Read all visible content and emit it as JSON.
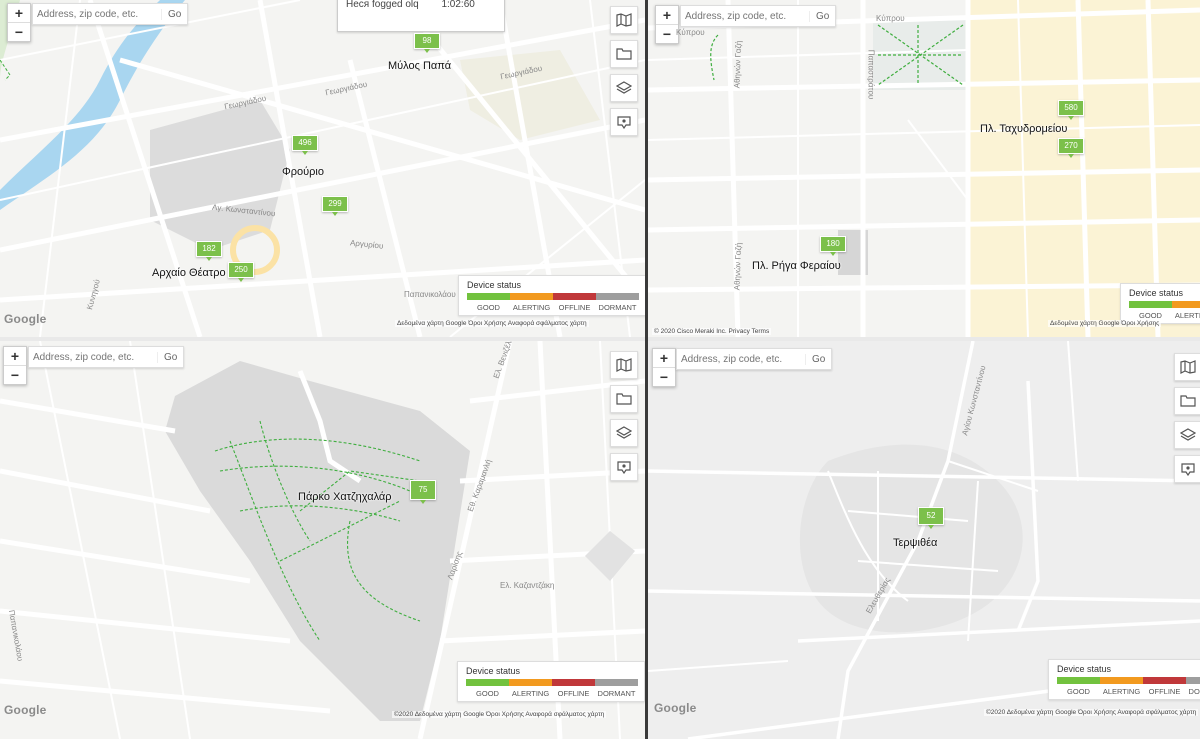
{
  "search": {
    "placeholder": "Address, zip code, etc.",
    "go": "Go"
  },
  "legend": {
    "title": "Device status",
    "labels": [
      "GOOD",
      "ALERTING",
      "OFFLINE",
      "DORMANT"
    ],
    "colors": [
      "#72c23e",
      "#f29a1f",
      "#c0383a",
      "#9e9e9e"
    ]
  },
  "colors": {
    "marker": "#7cc04b",
    "park_path": "#3fae3f"
  },
  "icons": [
    "map-icon",
    "folder-icon",
    "layers-icon",
    "monitor-pin-icon"
  ],
  "panel1": {
    "timebox": {
      "label": "Неся fogged olq",
      "value": "1:02:60"
    },
    "places": [
      "Μύλος Παπά",
      "Φρούριο",
      "Αρχαίο Θέατρο"
    ],
    "markers": [
      "98",
      "496",
      "299",
      "182",
      "250"
    ],
    "streets": [
      "Γεωργιάδου",
      "Γεωργιάδου",
      "Γεωργιάδου",
      "Αγ. Κωνσταντίνου",
      "Αργυρίου",
      "Κυνηγού",
      "Παπανικολάου"
    ],
    "attrib": "Δεδομένα χάρτη Google   Όροι Χρήσης   Αναφορά σφάλματος χάρτη"
  },
  "panel2": {
    "places": [
      "Πλ. Ταχυδρομείου",
      "Πλ. Ρήγα Φεραίου"
    ],
    "markers": [
      "580",
      "270",
      "180"
    ],
    "streets": [
      "Κύπρου",
      "Αθηνών Γαζή",
      "Παπαστράτου",
      "Κύπρου",
      "Αθηνών Γαζή"
    ],
    "attrib_left": "© 2020 Cisco Meraki Inc.   Privacy   Terms",
    "attrib_right": "Δεδομένα χάρτη Google   Όροι Χρήσης"
  },
  "panel3": {
    "places": [
      "Πάρκο Χατζηχαλάρ"
    ],
    "markers": [
      "75"
    ],
    "streets": [
      "Ελ. Βενιζέλου",
      "Εθ. Καραμανλή",
      "Λαρίσης",
      "Ελ. Καζαντζάκη",
      "Παπανικολάου"
    ],
    "attrib": "©2020 Δεδομένα χάρτη Google   Όροι Χρήσης   Αναφορά σφάλματος χάρτη"
  },
  "panel4": {
    "places": [
      "Τερψιθέα"
    ],
    "markers": [
      "52"
    ],
    "streets": [
      "Αγίου Κωνσταντίνου",
      "Ελευθερίας"
    ],
    "attrib": "©2020 Δεδομένα χάρτη Google   Όροι Χρήσης   Αναφορά σφάλματος χάρτη"
  },
  "google": "Google"
}
